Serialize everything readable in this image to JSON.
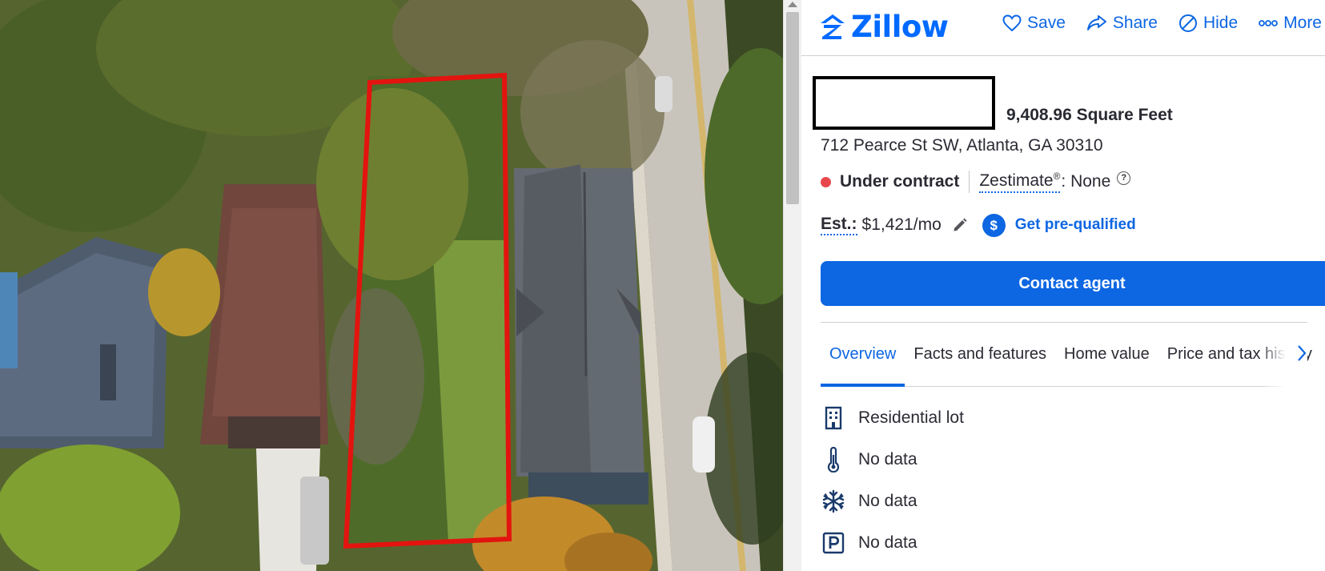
{
  "header": {
    "logo_text": "Zillow",
    "actions": [
      {
        "label": "Save",
        "icon": "heart-icon"
      },
      {
        "label": "Share",
        "icon": "share-icon"
      },
      {
        "label": "Hide",
        "icon": "hide-icon"
      },
      {
        "label": "More",
        "icon": "more-icon"
      }
    ]
  },
  "listing": {
    "area": "9,408.96 Square Feet",
    "address": "712 Pearce St SW, Atlanta, GA 30310",
    "status": "Under contract",
    "zestimate_label": "Zestimate",
    "zestimate_reg": "®",
    "zestimate_value": ": None",
    "help": "?",
    "est_label": "Est.:",
    "est_value": "$1,421/mo",
    "dollar_symbol": "$",
    "prequalify_label": "Get pre-qualified"
  },
  "contact_button": "Contact agent",
  "tabs": [
    {
      "label": "Overview",
      "active": true
    },
    {
      "label": "Facts and features",
      "active": false
    },
    {
      "label": "Home value",
      "active": false
    },
    {
      "label": "Price and tax history",
      "active": false
    }
  ],
  "facts": [
    {
      "label": "Residential lot",
      "icon": "building-icon"
    },
    {
      "label": "No data",
      "icon": "thermometer-icon"
    },
    {
      "label": "No data",
      "icon": "snowflake-icon"
    },
    {
      "label": "No data",
      "icon": "parking-icon"
    }
  ],
  "colors": {
    "accent": "#0d66e2",
    "logo": "#006aff",
    "status_dot": "#e8484b",
    "lot_outline": "#e3140f"
  }
}
